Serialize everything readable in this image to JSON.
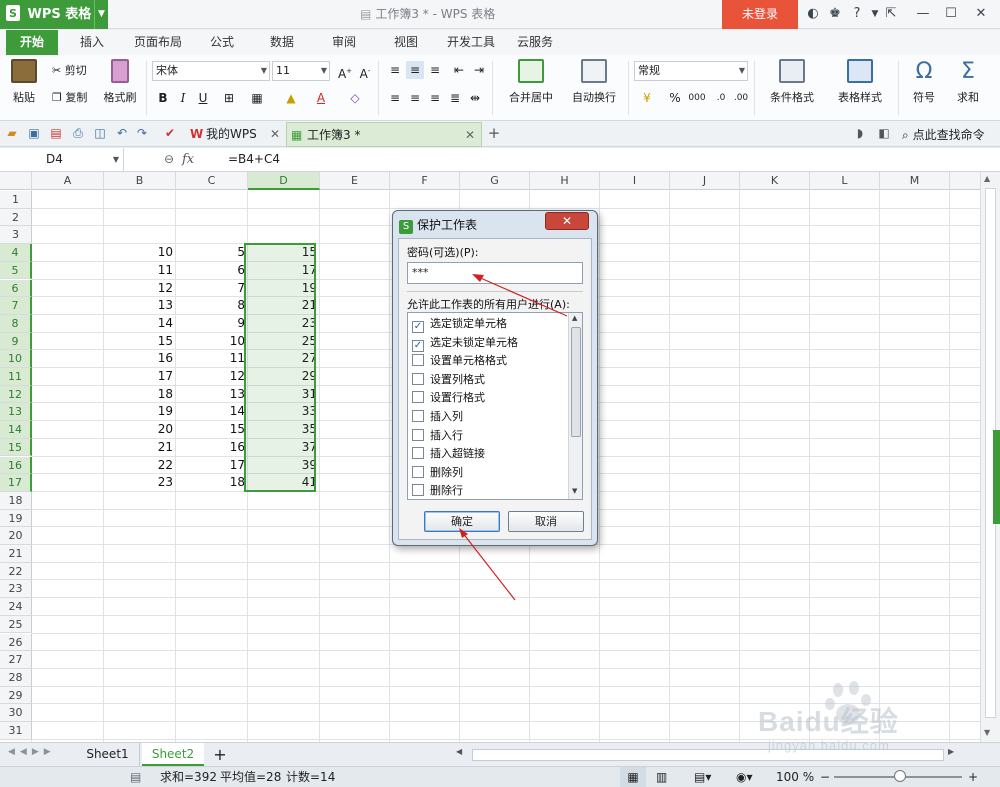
{
  "app": {
    "name": "WPS 表格",
    "doc_title": "工作簿3 * - WPS 表格",
    "login": "未登录"
  },
  "ribbon_tabs": [
    "开始",
    "插入",
    "页面布局",
    "公式",
    "数据",
    "审阅",
    "视图",
    "开发工具",
    "云服务"
  ],
  "ribbon": {
    "paste": "粘贴",
    "cut": "剪切",
    "copy": "复制",
    "format_painter": "格式刷",
    "font_name": "宋体",
    "font_size": "11",
    "merge_center": "合并居中",
    "wrap_text": "自动换行",
    "number_format": "常规",
    "conditional_format": "条件格式",
    "table_style": "表格样式",
    "symbol": "符号",
    "sum": "求和",
    "bold": "B",
    "italic": "I",
    "underline": "U",
    "percent": "%",
    "comma": "000"
  },
  "doc_tabs": {
    "my_wps": "我的WPS",
    "workbook": "工作簿3 *",
    "search_cmd": "点此查找命令"
  },
  "formula_bar": {
    "cell_ref": "D4",
    "fx": "fx",
    "formula": "=B4+C4"
  },
  "grid": {
    "columns": [
      "A",
      "B",
      "C",
      "D",
      "E",
      "F",
      "G",
      "H",
      "I",
      "J",
      "K",
      "L",
      "M"
    ],
    "rows": [
      "1",
      "2",
      "3",
      "4",
      "5",
      "6",
      "7",
      "8",
      "9",
      "10",
      "11",
      "12",
      "13",
      "14",
      "15",
      "16",
      "17",
      "18",
      "19",
      "20",
      "21",
      "22",
      "23",
      "24",
      "25",
      "26",
      "27",
      "28",
      "29",
      "30",
      "31"
    ],
    "col_b": [
      "10",
      "11",
      "12",
      "13",
      "14",
      "15",
      "16",
      "17",
      "18",
      "19",
      "20",
      "21",
      "22",
      "23"
    ],
    "col_c": [
      "5",
      "6",
      "7",
      "8",
      "9",
      "10",
      "11",
      "12",
      "13",
      "14",
      "15",
      "16",
      "17",
      "18"
    ],
    "col_d": [
      "15",
      "17",
      "19",
      "21",
      "23",
      "25",
      "27",
      "29",
      "31",
      "33",
      "35",
      "37",
      "39",
      "41"
    ]
  },
  "dialog": {
    "title": "保护工作表",
    "password_label": "密码(可选)(P):",
    "password_value": "***",
    "allow_label": "允许此工作表的所有用户进行(A):",
    "permissions": [
      {
        "label": "选定锁定单元格",
        "checked": true
      },
      {
        "label": "选定未锁定单元格",
        "checked": true
      },
      {
        "label": "设置单元格格式",
        "checked": false
      },
      {
        "label": "设置列格式",
        "checked": false
      },
      {
        "label": "设置行格式",
        "checked": false
      },
      {
        "label": "插入列",
        "checked": false
      },
      {
        "label": "插入行",
        "checked": false
      },
      {
        "label": "插入超链接",
        "checked": false
      },
      {
        "label": "删除列",
        "checked": false
      },
      {
        "label": "删除行",
        "checked": false
      }
    ],
    "ok": "确定",
    "cancel": "取消"
  },
  "sheets": [
    "Sheet1",
    "Sheet2"
  ],
  "status": {
    "sum": "求和=392",
    "average": "平均值=28",
    "count": "计数=14",
    "zoom": "100 %"
  },
  "watermark": {
    "brand": "Baidu经验",
    "url": "jingyan.baidu.com"
  },
  "colors": {
    "accent": "#3d9b3a",
    "login": "#e8533a",
    "arrow": "#cc2222"
  }
}
